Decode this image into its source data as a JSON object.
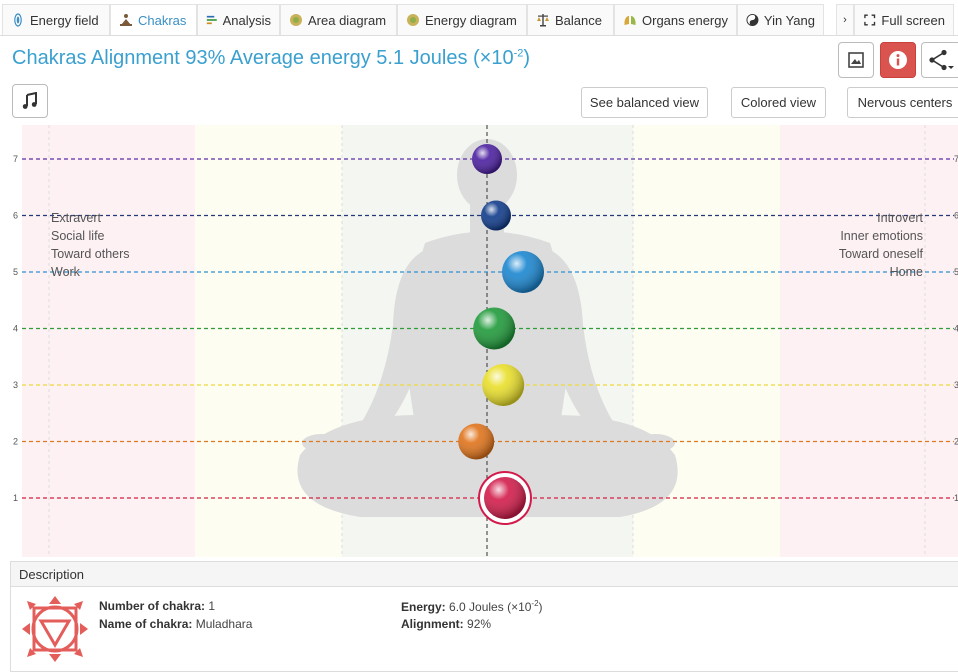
{
  "tabs": [
    {
      "label": "Energy field",
      "icon": "energy-field-icon"
    },
    {
      "label": "Chakras",
      "icon": "meditation-icon",
      "active": true
    },
    {
      "label": "Analysis",
      "icon": "analysis-bars-icon"
    },
    {
      "label": "Area diagram",
      "icon": "area-diagram-icon"
    },
    {
      "label": "Energy diagram",
      "icon": "energy-diagram-icon"
    },
    {
      "label": "Balance",
      "icon": "balance-icon"
    },
    {
      "label": "Organs energy",
      "icon": "lungs-icon"
    },
    {
      "label": "Yin Yang",
      "icon": "yin-yang-icon"
    }
  ],
  "tab_scroll": "›",
  "fullscreen_label": "Full screen",
  "title": {
    "prefix": "Chakras Alignment 93% Average energy 5.1 Joules (×10",
    "exponent": "-2",
    "suffix": ")"
  },
  "buttons": {
    "balanced_view": "See balanced view",
    "colored_view": "Colored view",
    "nervous_centers": "Nervous centers"
  },
  "chart": {
    "left_labels": [
      "Extravert",
      "Social life",
      "Toward others",
      "Work"
    ],
    "right_labels": [
      "Introvert",
      "Inner emotions",
      "Toward oneself",
      "Home"
    ],
    "levels": [
      {
        "n": "7",
        "color": "#5b2ea6"
      },
      {
        "n": "6",
        "color": "#23397a"
      },
      {
        "n": "5",
        "color": "#2f8fcf"
      },
      {
        "n": "4",
        "color": "#2e9d3a"
      },
      {
        "n": "3",
        "color": "#f0d93a"
      },
      {
        "n": "2",
        "color": "#e0791e"
      },
      {
        "n": "1",
        "color": "#d4213f"
      }
    ],
    "chakras": [
      {
        "level": 7,
        "offset": 0.0,
        "size": "small",
        "color": "#4b1fa0"
      },
      {
        "level": 6,
        "offset": 0.5,
        "size": "small",
        "color": "#0f3b8a"
      },
      {
        "level": 5,
        "offset": 2.0,
        "size": "large",
        "color": "#1a86d0"
      },
      {
        "level": 4,
        "offset": 0.4,
        "size": "large",
        "color": "#1f9a3a"
      },
      {
        "level": 3,
        "offset": 0.9,
        "size": "large",
        "color": "#e9df2a"
      },
      {
        "level": 2,
        "offset": -0.6,
        "size": "medium",
        "color": "#e0731a"
      },
      {
        "level": 1,
        "offset": 1.0,
        "size": "large",
        "color": "#d21b4a",
        "selected": true
      }
    ]
  },
  "description": {
    "header": "Description",
    "number_label": "Number of chakra:",
    "number_value": "1",
    "name_label": "Name of chakra:",
    "name_value": "Muladhara",
    "energy_label": "Energy:",
    "energy_value_prefix": "6.0 Joules (×10",
    "energy_exponent": "-2",
    "energy_suffix": ")",
    "alignment_label": "Alignment:",
    "alignment_value": "92%"
  }
}
